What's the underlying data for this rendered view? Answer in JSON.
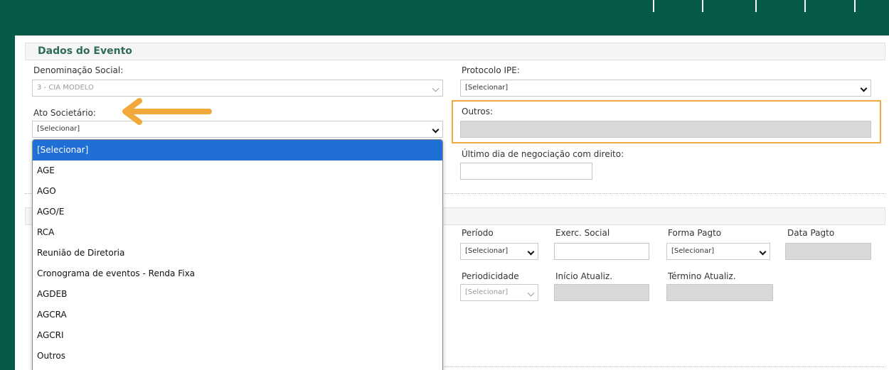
{
  "section": {
    "title": "Dados do Evento"
  },
  "fields": {
    "denominacao": {
      "label": "Denominação Social:",
      "value": "3 - CIA MODELO"
    },
    "protocolo": {
      "label": "Protocolo IPE:",
      "value": "[Selecionar]"
    },
    "ato": {
      "label": "Ato Societário:",
      "value": "[Selecionar]"
    },
    "outros": {
      "label": "Outros:"
    },
    "ultimo_dia": {
      "label": "Último dia de negociação com direito:"
    },
    "periodo": {
      "label": "Período",
      "value": "[Selecionar]"
    },
    "exerc_social": {
      "label": "Exerc. Social"
    },
    "forma_pagto": {
      "label": "Forma Pagto",
      "value": "[Selecionar]"
    },
    "data_pagto": {
      "label": "Data Pagto"
    },
    "periodicidade": {
      "label": "Periodicidade",
      "value": "[Selecionar]"
    },
    "inicio_atualiz": {
      "label": "Início Atualiz."
    },
    "termino_atualiz": {
      "label": "Término Atualiz."
    }
  },
  "dropdown": {
    "items": [
      "[Selecionar]",
      "AGE",
      "AGO",
      "AGO/E",
      "RCA",
      "Reunião de Diretoria",
      "Cronograma de eventos - Renda Fixa",
      "AGDEB",
      "AGCRA",
      "AGCRI",
      "Outros"
    ],
    "selected_index": 0
  },
  "colors": {
    "background": "#075a47",
    "accent": "#f0a93a",
    "selected": "#1f6fd6",
    "title": "#2e6b58"
  },
  "icons": {
    "arrow": "arrow-left-icon",
    "chevron": "chevron-down-icon"
  }
}
